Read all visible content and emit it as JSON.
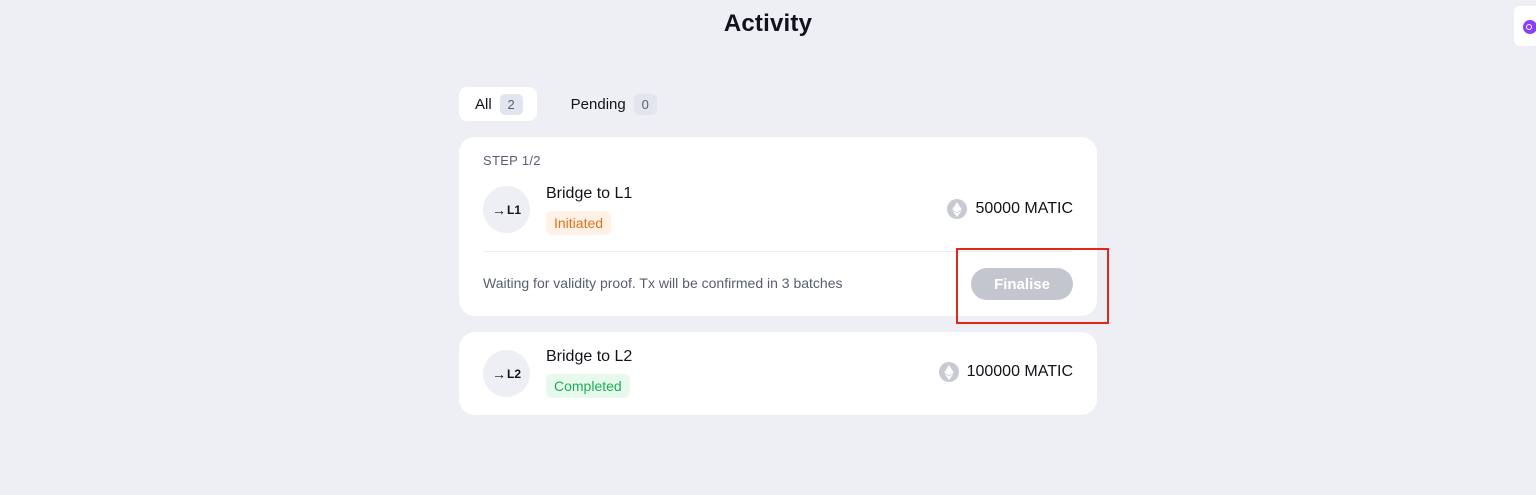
{
  "page": {
    "title": "Activity"
  },
  "tabs": [
    {
      "label": "All",
      "count": "2",
      "active": true
    },
    {
      "label": "Pending",
      "count": "0",
      "active": false
    }
  ],
  "transactions": [
    {
      "step": "STEP 1/2",
      "avatar_arrow": "→",
      "avatar_label": "L1",
      "title": "Bridge to L1",
      "status": "Initiated",
      "amount": "50000 MATIC",
      "token_icon": "ethereum-icon",
      "info": "Waiting for validity proof. Tx will be confirmed in 3 batches",
      "action_label": "Finalise"
    },
    {
      "avatar_arrow": "→",
      "avatar_label": "L2",
      "title": "Bridge to L2",
      "status": "Completed",
      "amount": "100000 MATIC",
      "token_icon": "ethereum-icon"
    }
  ],
  "colors": {
    "background": "#eeeff4",
    "card": "#ffffff",
    "initiated": "#e0731a",
    "completed": "#1bb152",
    "button_disabled": "#c4c6cf",
    "highlight": "#e1261c"
  }
}
